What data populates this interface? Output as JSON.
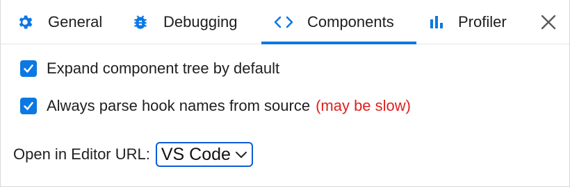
{
  "tabs": [
    {
      "label": "General",
      "icon": "gear-icon",
      "active": false
    },
    {
      "label": "Debugging",
      "icon": "bug-icon",
      "active": false
    },
    {
      "label": "Components",
      "icon": "code-brackets-icon",
      "active": true
    },
    {
      "label": "Profiler",
      "icon": "bar-chart-icon",
      "active": false
    }
  ],
  "close_icon": "close-icon",
  "settings": {
    "expand_tree": {
      "label": "Expand component tree by default",
      "checked": true
    },
    "parse_hooks": {
      "label": "Always parse hook names from source",
      "note": "(may be slow)",
      "checked": true
    }
  },
  "editor": {
    "label": "Open in Editor URL:",
    "selected": "VS Code"
  },
  "colors": {
    "accent": "#0b78e3",
    "warning": "#e01e1e"
  }
}
